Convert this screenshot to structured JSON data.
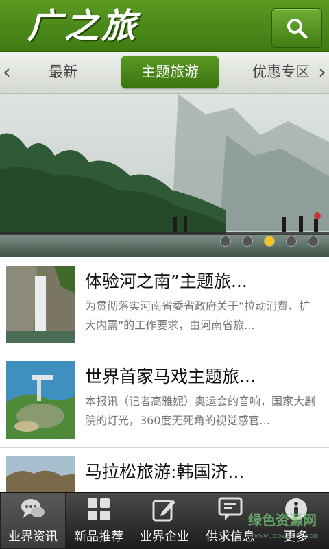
{
  "header": {
    "logo_text": "广之旅",
    "search_icon": "search-icon"
  },
  "tabs": {
    "left_arrow": "‹",
    "right_arrow": "›",
    "items": [
      {
        "label": "最新",
        "active": false
      },
      {
        "label": "主题旅游",
        "active": true
      },
      {
        "label": "优惠专区",
        "active": false
      }
    ]
  },
  "banner": {
    "slides_total": 5,
    "active_index": 2
  },
  "news": [
    {
      "title": "体验河之南”主题旅...",
      "desc": "为贯彻落实河南省委省政府关于“拉动消费、扩大内需”的工作要求，由河南省旅..."
    },
    {
      "title": "世界首家马戏主题旅...",
      "desc": "本报讯（记者高雅妮）奥运会的音响，国家大剧院的灯光，360度无死角的视觉感官..."
    },
    {
      "title": "马拉松旅游:韩国济...",
      "desc": ""
    }
  ],
  "bottom_nav": [
    {
      "label": "业界资讯",
      "icon": "chat-bubbles-icon",
      "active": true
    },
    {
      "label": "新品推荐",
      "icon": "grid-icon",
      "active": false
    },
    {
      "label": "业界企业",
      "icon": "edit-icon",
      "active": false
    },
    {
      "label": "供求信息",
      "icon": "message-icon",
      "active": false
    },
    {
      "label": "更多",
      "icon": "info-icon",
      "active": false
    }
  ],
  "watermark": {
    "text": "绿色资源网",
    "url_text": "www.downcc.com"
  },
  "colors": {
    "brand_green": "#4a8a1a",
    "active_dot": "#f5c520",
    "nav_bg": "#2a2a2a"
  }
}
